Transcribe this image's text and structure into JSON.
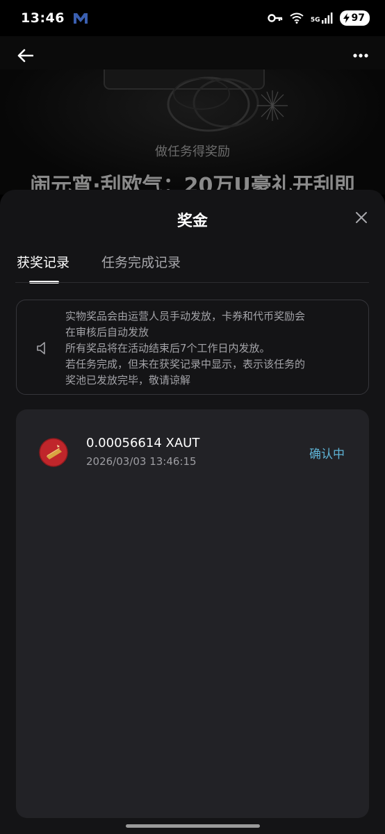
{
  "status_bar": {
    "time": "13:46",
    "network": "5G",
    "battery": "97"
  },
  "hero": {
    "subtitle": "做任务得奖励",
    "title": "闹元宵·刮欧气：20万U豪礼开刮即"
  },
  "sheet": {
    "title": "奖金",
    "tabs": [
      {
        "label": "获奖记录",
        "active": true
      },
      {
        "label": "任务完成记录",
        "active": false
      }
    ],
    "notice_lines": [
      "实物奖品会由运营人员手动发放，卡券和代币奖励会",
      "在审核后自动发放",
      "所有奖品将在活动结束后7个工作日内发放。",
      "若任务完成，但未在获奖记录中显示，表示该任务的",
      "奖池已发放完毕，敬请谅解"
    ],
    "records": [
      {
        "amount": "0.00056614 XAUT",
        "time": "2026/03/03 13:46:15",
        "status": "确认中"
      }
    ]
  },
  "colors": {
    "status_accent": "#5fb4d6",
    "sheet_bg": "#141416",
    "card_bg": "#222226",
    "coin_red": "#c0262b",
    "gold": "#d9a441"
  }
}
